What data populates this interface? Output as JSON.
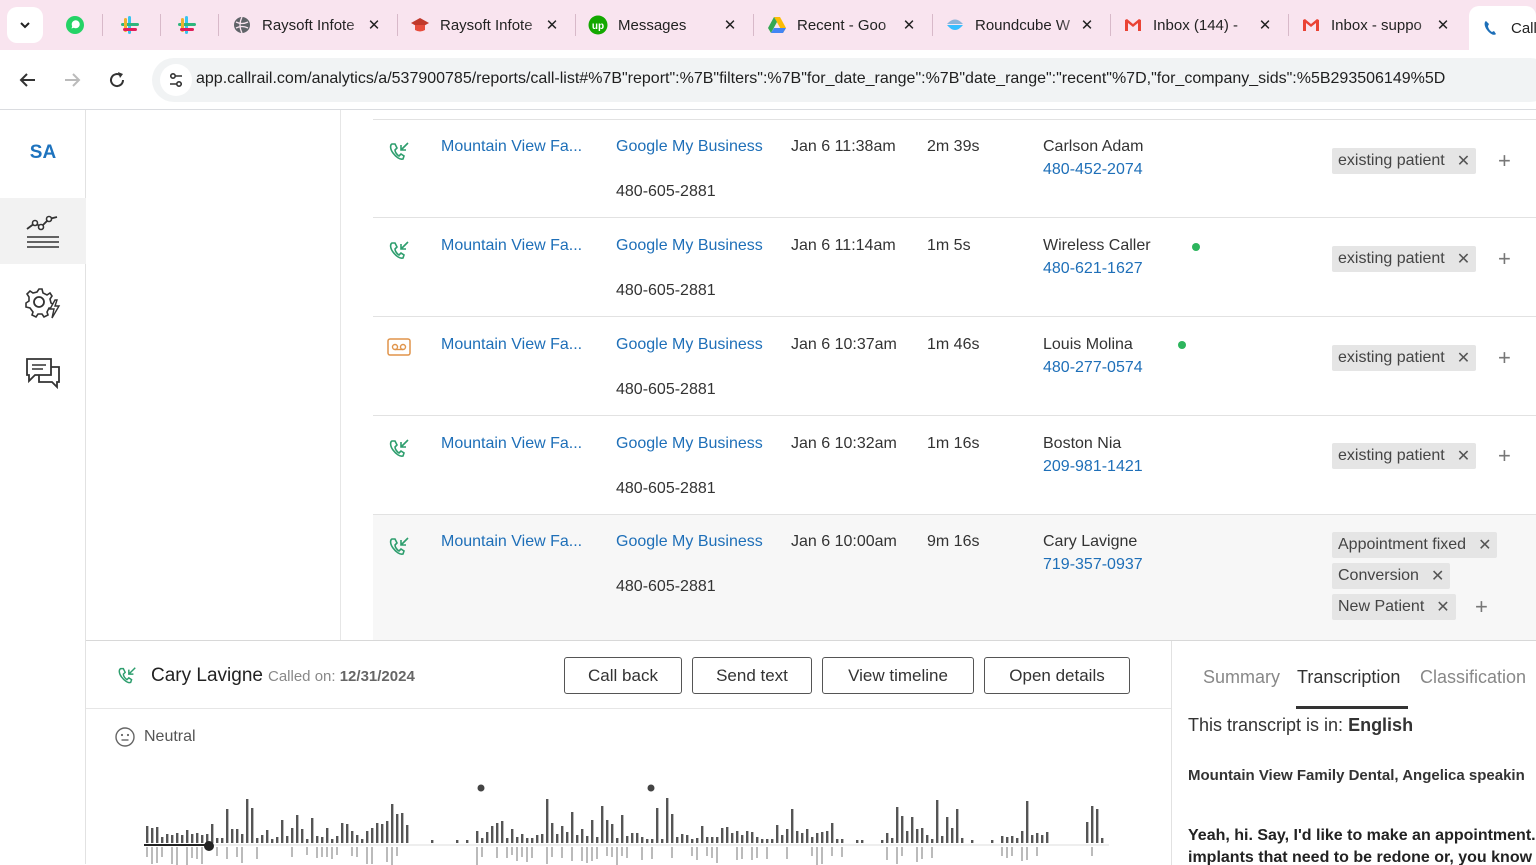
{
  "browser": {
    "tabs": [
      {
        "title": "",
        "icon": "whatsapp-icon"
      },
      {
        "title": "",
        "icon": "slack-icon"
      },
      {
        "title": "",
        "icon": "slack-icon"
      },
      {
        "title": "Raysoft Infote",
        "icon": "globe-icon"
      },
      {
        "title": "Raysoft Infote",
        "icon": "graduation-cap-icon"
      },
      {
        "title": "Messages",
        "icon": "upwork-icon"
      },
      {
        "title": "Recent - Goo",
        "icon": "google-drive-icon"
      },
      {
        "title": "Roundcube W",
        "icon": "roundcube-icon"
      },
      {
        "title": "Inbox (144) -",
        "icon": "gmail-icon"
      },
      {
        "title": "Inbox - suppo",
        "icon": "gmail-icon"
      },
      {
        "title": "Call",
        "icon": "callrail-icon"
      }
    ],
    "url": "app.callrail.com/analytics/a/537900785/reports/call-list#%7B\"report\":%7B\"filters\":%7B\"for_date_range\":%7B\"date_range\":\"recent\"%7D,\"for_company_sids\":%5B293506149%5D"
  },
  "rail": {
    "logo": "SA"
  },
  "calls": [
    {
      "company": "Mountain View Fa...",
      "source": "Google My Business",
      "tracking": "480-605-2881",
      "date": "Jan 6 11:38am",
      "duration": "2m 39s",
      "caller": "Carlson Adam",
      "number": "480-452-2074",
      "online": false,
      "icon": "inbound-call-icon",
      "tags": [
        "existing patient"
      ]
    },
    {
      "company": "Mountain View Fa...",
      "source": "Google My Business",
      "tracking": "480-605-2881",
      "date": "Jan 6 11:14am",
      "duration": "1m 5s",
      "caller": "Wireless Caller",
      "number": "480-621-1627",
      "online": true,
      "icon": "inbound-call-icon",
      "tags": [
        "existing patient"
      ]
    },
    {
      "company": "Mountain View Fa...",
      "source": "Google My Business",
      "tracking": "480-605-2881",
      "date": "Jan 6 10:37am",
      "duration": "1m 46s",
      "caller": "Louis Molina",
      "number": "480-277-0574",
      "online": true,
      "icon": "voicemail-icon",
      "tags": [
        "existing patient"
      ]
    },
    {
      "company": "Mountain View Fa...",
      "source": "Google My Business",
      "tracking": "480-605-2881",
      "date": "Jan 6 10:32am",
      "duration": "1m 16s",
      "caller": "Boston Nia",
      "number": "209-981-1421",
      "online": false,
      "icon": "inbound-call-icon",
      "tags": [
        "existing patient"
      ]
    },
    {
      "company": "Mountain View Fa...",
      "source": "Google My Business",
      "tracking": "480-605-2881",
      "date": "Jan 6 10:00am",
      "duration": "9m 16s",
      "caller": "Cary Lavigne",
      "number": "719-357-0937",
      "online": false,
      "icon": "inbound-call-icon",
      "tags": [
        "Appointment fixed",
        "Conversion",
        "New Patient"
      ]
    }
  ],
  "detail": {
    "caller": "Cary Lavigne",
    "called_label": "Called on:",
    "called_date": "12/31/2024",
    "buttons": {
      "call_back": "Call back",
      "send_text": "Send text",
      "view_timeline": "View timeline",
      "open_details": "Open details"
    },
    "sentiment": "Neutral",
    "tabs": {
      "summary": "Summary",
      "transcription": "Transcription",
      "classification": "Classification"
    },
    "lang_label": "This transcript is in:",
    "lang_value": "English",
    "transcript": [
      "Mountain View Family Dental, Angelica speakin",
      "Yeah, hi. Say, I'd like to make an appointment.",
      "implants that need to be redone or, you know"
    ]
  },
  "colors": {
    "link": "#1e6fb8",
    "call_icon": "#2e9e6e",
    "voicemail_icon": "#e0944a",
    "online_dot": "#2db55d",
    "tab_strip": "#f9e4ef"
  }
}
